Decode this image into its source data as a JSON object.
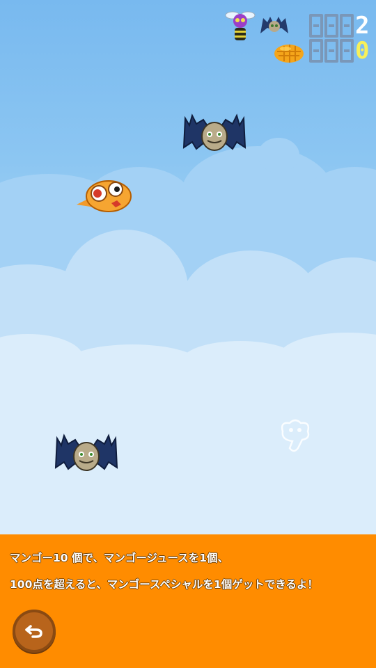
{
  "hud": {
    "kills_value": "2",
    "mango_value": "0",
    "kills_icons": [
      "bee-enemy-icon",
      "bat-enemy-icon"
    ],
    "mango_icon": "mango-icon"
  },
  "sprites": {
    "player": "orange-bird-icon",
    "enemies": [
      "bat-enemy-icon",
      "bat-enemy-icon"
    ],
    "ghost": "faded-bird-icon"
  },
  "info_panel": {
    "line1": "マンゴー10 個で、マンゴージュースを1個、",
    "line2": "100点を超えると、マンゴースペシャルを1個ゲットできるよ！",
    "back_icon": "back-arrow-icon"
  },
  "colors": {
    "panel_bg": "#ff8c00",
    "counter_unlit": "#7a97b8",
    "mango_counter": "#f7f05a"
  }
}
